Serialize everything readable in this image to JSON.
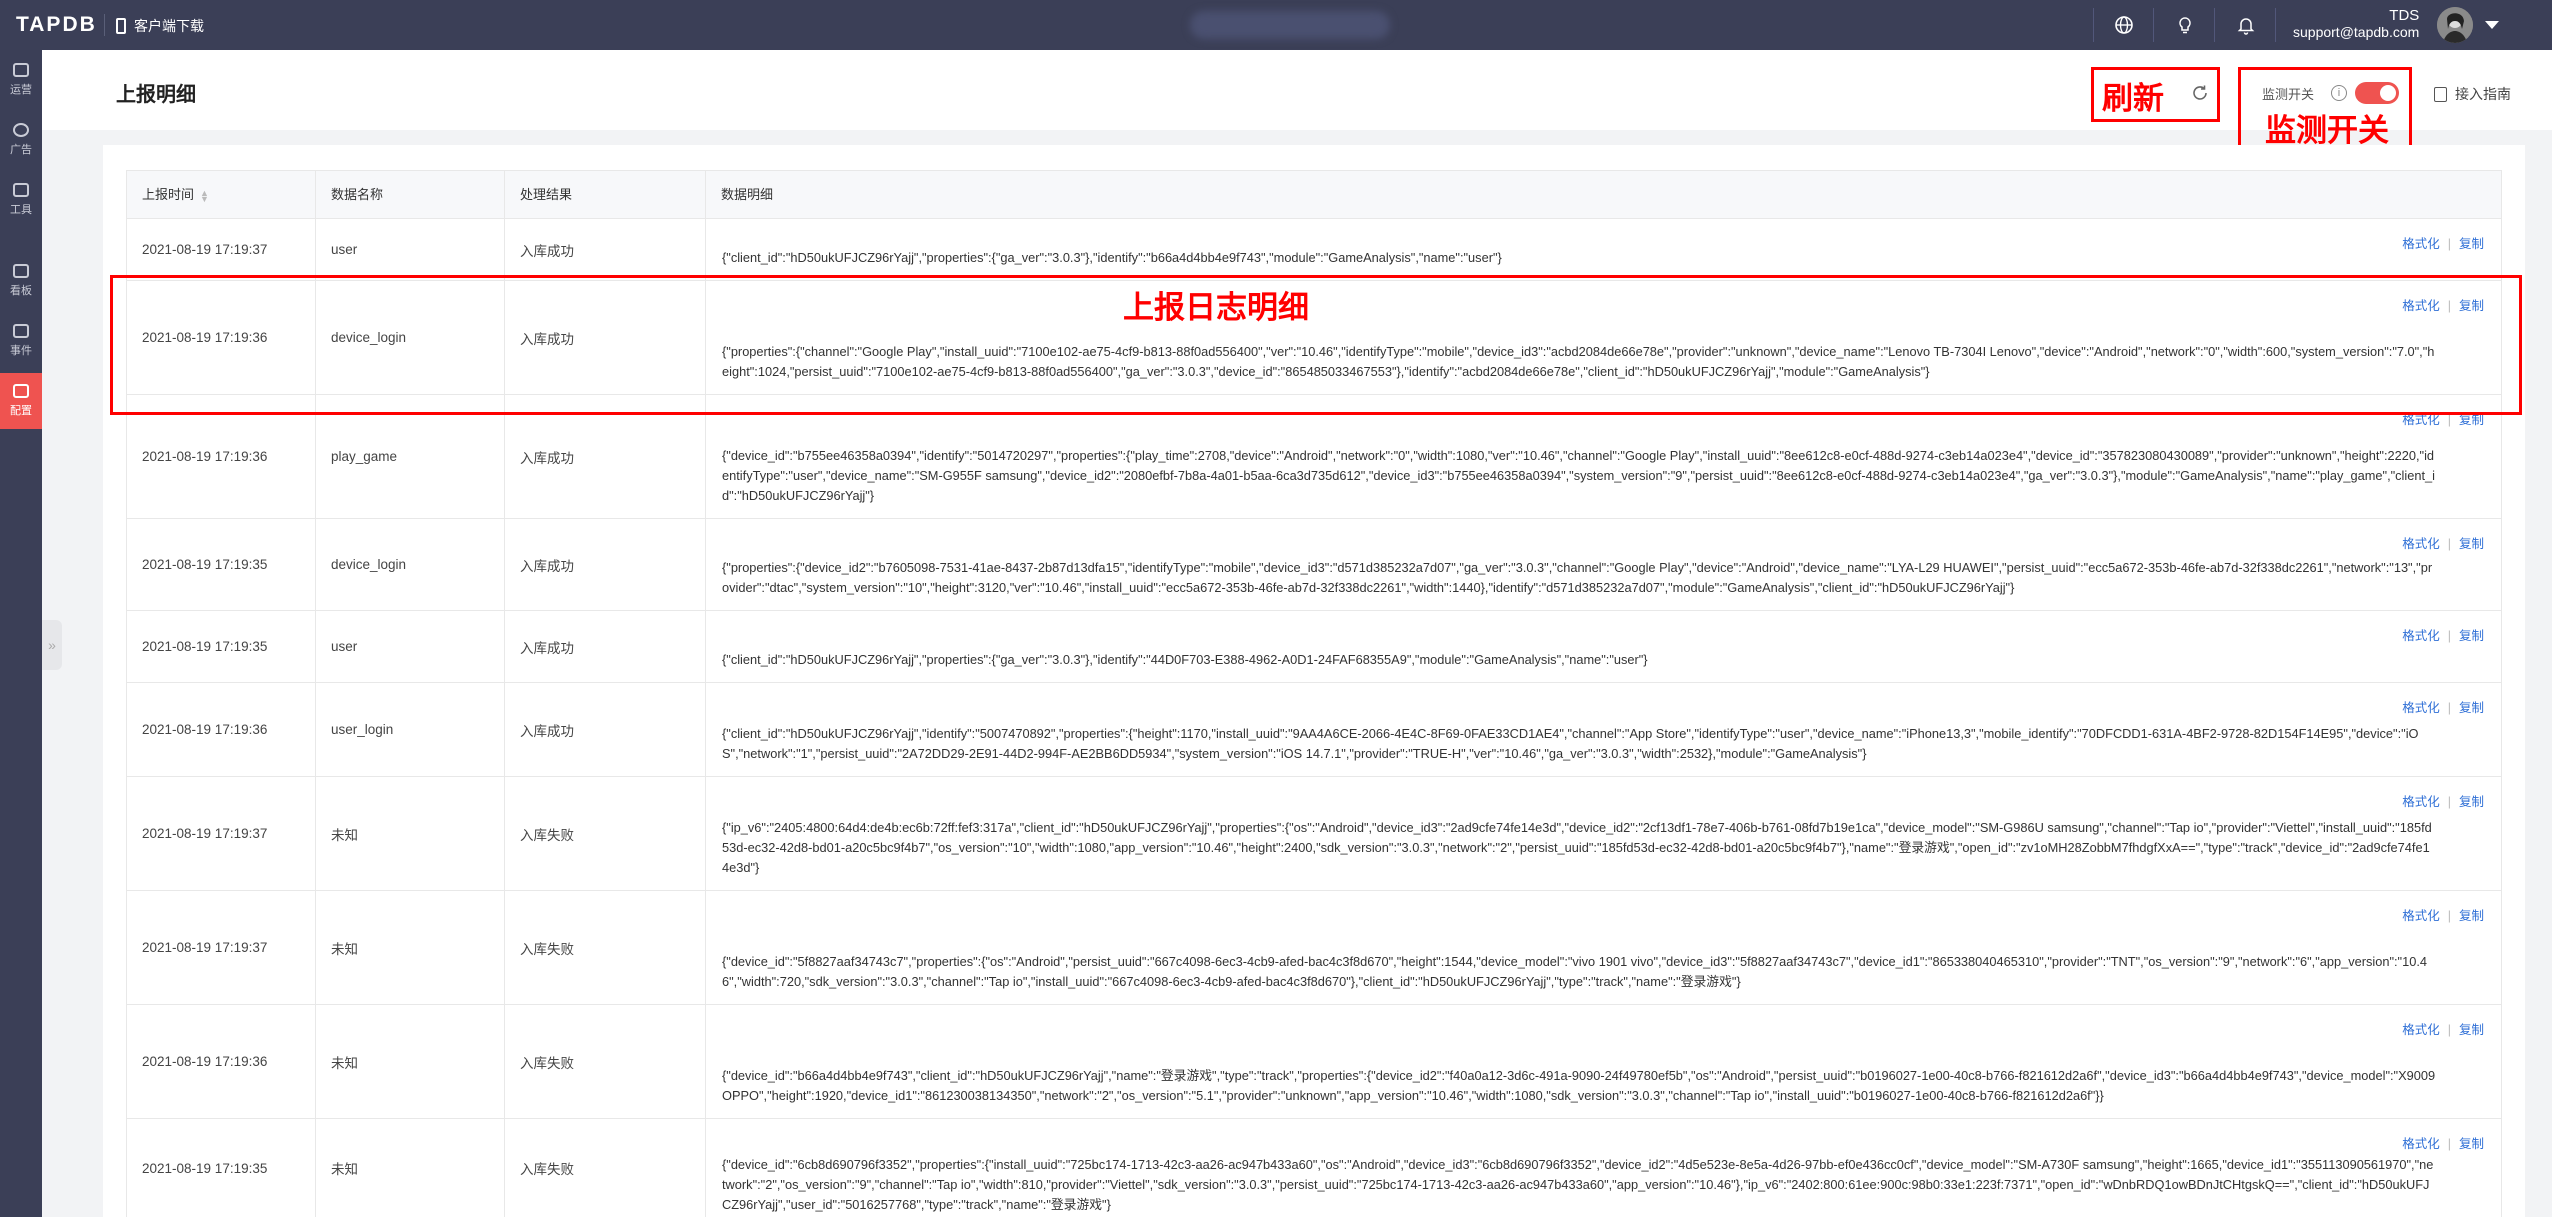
{
  "app": {
    "logo": "TAPDB",
    "download_label": "客户端下载"
  },
  "topbar": {
    "user_name": "TDS",
    "user_email": "support@tapdb.com"
  },
  "sidebar": {
    "items": [
      {
        "label": "运营",
        "icon": "chart-icon"
      },
      {
        "label": "广告",
        "icon": "ad-icon"
      },
      {
        "label": "工具",
        "icon": "toolbox-icon"
      },
      {
        "label": "看板",
        "icon": "dashboard-icon"
      },
      {
        "label": "事件",
        "icon": "event-icon"
      },
      {
        "label": "配置",
        "icon": "config-icon",
        "active": true
      }
    ]
  },
  "page": {
    "title": "上报明细",
    "monitor_label": "监测开关",
    "monitor_on": true,
    "guide_label": "接入指南"
  },
  "annotations": {
    "refresh": "刷新",
    "monitor": "监测开关",
    "detail": "上报日志明细"
  },
  "table": {
    "columns": [
      "上报时间",
      "数据名称",
      "处理结果",
      "数据明细"
    ],
    "action_format": "格式化",
    "action_copy": "复制",
    "rows": [
      {
        "time": "2021-08-19 17:19:37",
        "name": "user",
        "result": "入库成功",
        "detail": "{\"client_id\":\"hD50ukUFJCZ96rYajj\",\"properties\":{\"ga_ver\":\"3.0.3\"},\"identify\":\"b66a4d4bb4e9f743\",\"module\":\"GameAnalysis\",\"name\":\"user\"}"
      },
      {
        "time": "2021-08-19 17:19:36",
        "name": "device_login",
        "result": "入库成功",
        "detail": "{\"properties\":{\"channel\":\"Google Play\",\"install_uuid\":\"7100e102-ae75-4cf9-b813-88f0ad556400\",\"ver\":\"10.46\",\"identifyType\":\"mobile\",\"device_id3\":\"acbd2084de66e78e\",\"provider\":\"unknown\",\"device_name\":\"Lenovo TB-7304I Lenovo\",\"device\":\"Android\",\"network\":\"0\",\"width\":600,\"system_version\":\"7.0\",\"height\":1024,\"persist_uuid\":\"7100e102-ae75-4cf9-b813-88f0ad556400\",\"ga_ver\":\"3.0.3\",\"device_id\":\"865485033467553\"},\"identify\":\"acbd2084de66e78e\",\"client_id\":\"hD50ukUFJCZ96rYajj\",\"module\":\"GameAnalysis\"}"
      },
      {
        "time": "2021-08-19 17:19:36",
        "name": "play_game",
        "result": "入库成功",
        "detail": "{\"device_id\":\"b755ee46358a0394\",\"identify\":\"5014720297\",\"properties\":{\"play_time\":2708,\"device\":\"Android\",\"network\":\"0\",\"width\":1080,\"ver\":\"10.46\",\"channel\":\"Google Play\",\"install_uuid\":\"8ee612c8-e0cf-488d-9274-c3eb14a023e4\",\"device_id\":\"357823080430089\",\"provider\":\"unknown\",\"height\":2220,\"identifyType\":\"user\",\"device_name\":\"SM-G955F samsung\",\"device_id2\":\"2080efbf-7b8a-4a01-b5aa-6ca3d735d612\",\"device_id3\":\"b755ee46358a0394\",\"system_version\":\"9\",\"persist_uuid\":\"8ee612c8-e0cf-488d-9274-c3eb14a023e4\",\"ga_ver\":\"3.0.3\"},\"module\":\"GameAnalysis\",\"name\":\"play_game\",\"client_id\":\"hD50ukUFJCZ96rYajj\"}"
      },
      {
        "time": "2021-08-19 17:19:35",
        "name": "device_login",
        "result": "入库成功",
        "detail": "{\"properties\":{\"device_id2\":\"b7605098-7531-41ae-8437-2b87d13dfa15\",\"identifyType\":\"mobile\",\"device_id3\":\"d571d385232a7d07\",\"ga_ver\":\"3.0.3\",\"channel\":\"Google Play\",\"device\":\"Android\",\"device_name\":\"LYA-L29 HUAWEI\",\"persist_uuid\":\"ecc5a672-353b-46fe-ab7d-32f338dc2261\",\"network\":\"13\",\"provider\":\"dtac\",\"system_version\":\"10\",\"height\":3120,\"ver\":\"10.46\",\"install_uuid\":\"ecc5a672-353b-46fe-ab7d-32f338dc2261\",\"width\":1440},\"identify\":\"d571d385232a7d07\",\"module\":\"GameAnalysis\",\"client_id\":\"hD50ukUFJCZ96rYajj\"}"
      },
      {
        "time": "2021-08-19 17:19:35",
        "name": "user",
        "result": "入库成功",
        "detail": "{\"client_id\":\"hD50ukUFJCZ96rYajj\",\"properties\":{\"ga_ver\":\"3.0.3\"},\"identify\":\"44D0F703-E388-4962-A0D1-24FAF68355A9\",\"module\":\"GameAnalysis\",\"name\":\"user\"}"
      },
      {
        "time": "2021-08-19 17:19:36",
        "name": "user_login",
        "result": "入库成功",
        "detail": "{\"client_id\":\"hD50ukUFJCZ96rYajj\",\"identify\":\"5007470892\",\"properties\":{\"height\":1170,\"install_uuid\":\"9AA4A6CE-2066-4E4C-8F69-0FAE33CD1AE4\",\"channel\":\"App Store\",\"identifyType\":\"user\",\"device_name\":\"iPhone13,3\",\"mobile_identify\":\"70DFCDD1-631A-4BF2-9728-82D154F14E95\",\"device\":\"iOS\",\"network\":\"1\",\"persist_uuid\":\"2A72DD29-2E91-44D2-994F-AE2BB6DD5934\",\"system_version\":\"iOS 14.7.1\",\"provider\":\"TRUE-H\",\"ver\":\"10.46\",\"ga_ver\":\"3.0.3\",\"width\":2532},\"module\":\"GameAnalysis\"}"
      },
      {
        "time": "2021-08-19 17:19:37",
        "name": "未知",
        "result": "入库失败",
        "detail": "{\"ip_v6\":\"2405:4800:64d4:de4b:ec6b:72ff:fef3:317a\",\"client_id\":\"hD50ukUFJCZ96rYajj\",\"properties\":{\"os\":\"Android\",\"device_id3\":\"2ad9cfe74fe14e3d\",\"device_id2\":\"2cf13df1-78e7-406b-b761-08fd7b19e1ca\",\"device_model\":\"SM-G986U samsung\",\"channel\":\"Tap io\",\"provider\":\"Viettel\",\"install_uuid\":\"185fd53d-ec32-42d8-bd01-a20c5bc9f4b7\",\"os_version\":\"10\",\"width\":1080,\"app_version\":\"10.46\",\"height\":2400,\"sdk_version\":\"3.0.3\",\"network\":\"2\",\"persist_uuid\":\"185fd53d-ec32-42d8-bd01-a20c5bc9f4b7\"},\"name\":\"登录游戏\",\"open_id\":\"zv1oMH28ZobbM7fhdgfXxA==\",\"type\":\"track\",\"device_id\":\"2ad9cfe74fe14e3d\"}"
      },
      {
        "time": "2021-08-19 17:19:37",
        "name": "未知",
        "result": "入库失败",
        "detail": "{\"device_id\":\"5f8827aaf34743c7\",\"properties\":{\"os\":\"Android\",\"persist_uuid\":\"667c4098-6ec3-4cb9-afed-bac4c3f8d670\",\"height\":1544,\"device_model\":\"vivo 1901 vivo\",\"device_id3\":\"5f8827aaf34743c7\",\"device_id1\":\"865338040465310\",\"provider\":\"TNT\",\"os_version\":\"9\",\"network\":\"6\",\"app_version\":\"10.46\",\"width\":720,\"sdk_version\":\"3.0.3\",\"channel\":\"Tap io\",\"install_uuid\":\"667c4098-6ec3-4cb9-afed-bac4c3f8d670\"},\"client_id\":\"hD50ukUFJCZ96rYajj\",\"type\":\"track\",\"name\":\"登录游戏\"}"
      },
      {
        "time": "2021-08-19 17:19:36",
        "name": "未知",
        "result": "入库失败",
        "detail": "{\"device_id\":\"b66a4d4bb4e9f743\",\"client_id\":\"hD50ukUFJCZ96rYajj\",\"name\":\"登录游戏\",\"type\":\"track\",\"properties\":{\"device_id2\":\"f40a0a12-3d6c-491a-9090-24f49780ef5b\",\"os\":\"Android\",\"persist_uuid\":\"b0196027-1e00-40c8-b766-f821612d2a6f\",\"device_id3\":\"b66a4d4bb4e9f743\",\"device_model\":\"X9009 OPPO\",\"height\":1920,\"device_id1\":\"861230038134350\",\"network\":\"2\",\"os_version\":\"5.1\",\"provider\":\"unknown\",\"app_version\":\"10.46\",\"width\":1080,\"sdk_version\":\"3.0.3\",\"channel\":\"Tap io\",\"install_uuid\":\"b0196027-1e00-40c8-b766-f821612d2a6f\"}}"
      },
      {
        "time": "2021-08-19 17:19:35",
        "name": "未知",
        "result": "入库失败",
        "detail": "{\"device_id\":\"6cb8d690796f3352\",\"properties\":{\"install_uuid\":\"725bc174-1713-42c3-aa26-ac947b433a60\",\"os\":\"Android\",\"device_id3\":\"6cb8d690796f3352\",\"device_id2\":\"4d5e523e-8e5a-4d26-97bb-ef0e436cc0cf\",\"device_model\":\"SM-A730F samsung\",\"height\":1665,\"device_id1\":\"355113090561970\",\"network\":\"2\",\"os_version\":\"9\",\"channel\":\"Tap io\",\"width\":810,\"provider\":\"Viettel\",\"sdk_version\":\"3.0.3\",\"persist_uuid\":\"725bc174-1713-42c3-aa26-ac947b433a60\",\"app_version\":\"10.46\"},\"ip_v6\":\"2402:800:61ee:900c:98b0:33e1:223f:7371\",\"open_id\":\"wDnbRDQ1owBDnJtCHtgskQ==\",\"client_id\":\"hD50ukUFJCZ96rYajj\",\"user_id\":\"5016257768\",\"type\":\"track\",\"name\":\"登录游戏\"}"
      }
    ]
  }
}
